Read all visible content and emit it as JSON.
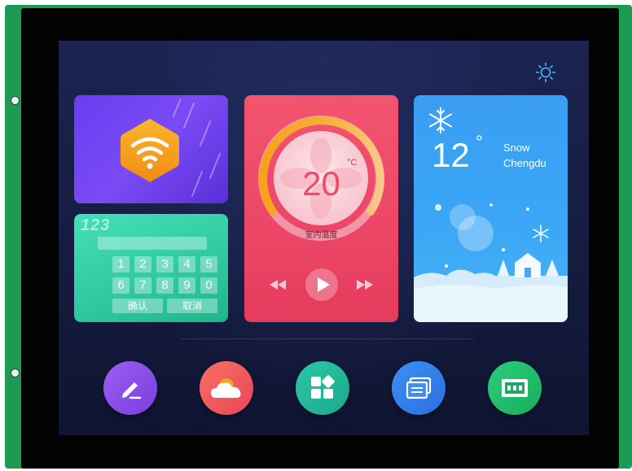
{
  "keypad": {
    "title": "123",
    "keys": [
      "1",
      "2",
      "3",
      "4",
      "5",
      "6",
      "7",
      "8",
      "9",
      "0"
    ],
    "confirm": "确认",
    "cancel": "取消"
  },
  "thermostat": {
    "value": "20",
    "unit": "°C",
    "label": "室内温度"
  },
  "weather": {
    "temperature": "12",
    "degree": "°",
    "condition": "Snow",
    "city": "Chengdu"
  },
  "dock": {
    "icons": [
      "pen-icon",
      "cloud-icon",
      "apps-grid-icon",
      "stack-icon",
      "abc-board-icon"
    ]
  },
  "colors": {
    "wifi": "#7a4af5",
    "keypad": "#2fc8a0",
    "thermostat": "#ec4666",
    "weather": "#3aa6f5",
    "accent_orange": "#f7a21c"
  }
}
